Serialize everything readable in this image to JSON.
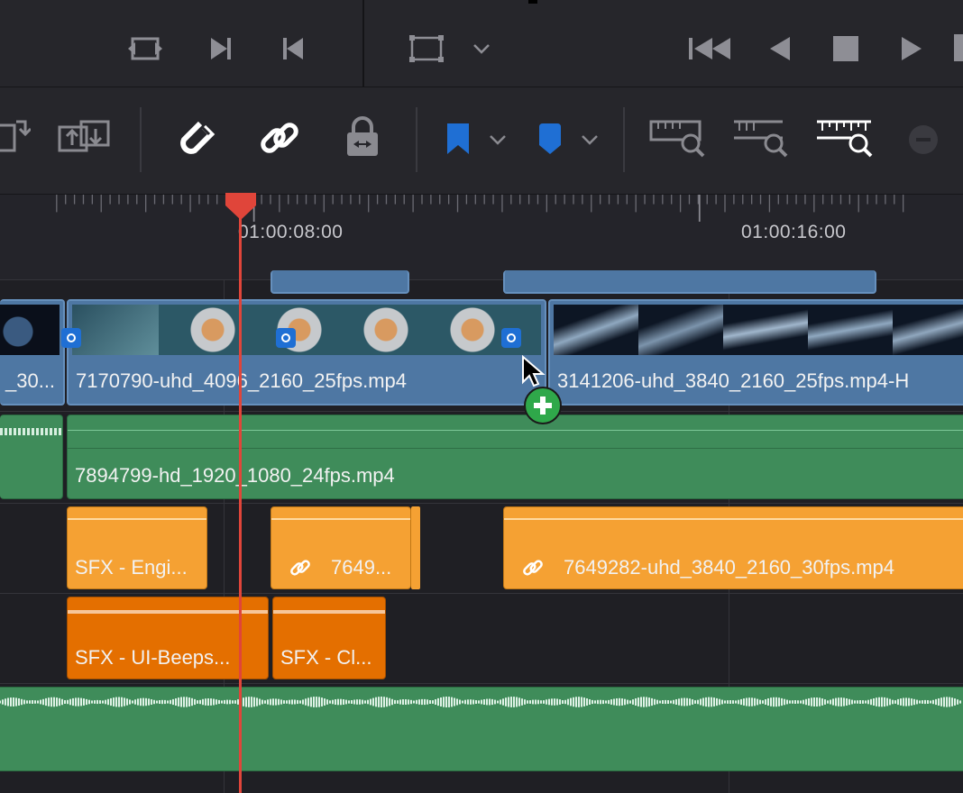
{
  "timeline": {
    "timecodes": [
      "01:00:08:00",
      "01:00:16:00"
    ]
  },
  "clips": {
    "video": [
      {
        "label": "_30..."
      },
      {
        "label": "7170790-uhd_4096_2160_25fps.mp4"
      },
      {
        "label": "3141206-uhd_3840_2160_25fps.mp4-H"
      }
    ],
    "green_audio": {
      "label": "7894799-hd_1920_1080_24fps.mp4"
    },
    "orange_row1": [
      {
        "label": "SFX - Engi..."
      },
      {
        "label": "7649..."
      },
      {
        "label": "7649282-uhd_3840_2160_30fps.mp4"
      }
    ],
    "orange_row2": [
      {
        "label": "SFX - UI-Beeps..."
      },
      {
        "label": "SFX - Cl..."
      }
    ]
  },
  "colors": {
    "playhead": "#e0453a",
    "video_clip": "#4e77a3",
    "audio_green": "#3f8c5a",
    "audio_orange": "#f5a133",
    "audio_dark_orange": "#e46f00",
    "marker_blue": "#1f6fd4",
    "add_badge": "#2fa84a"
  },
  "icons": {
    "transport": [
      "match-frame-icon",
      "next-edit-icon",
      "previous-edit-icon",
      "transform-icon",
      "go-to-start-icon",
      "reverse-play-icon",
      "stop-icon",
      "play-icon"
    ],
    "toolbar": [
      "insert-clip-icon",
      "overwrite-clip-icon",
      "snapping-magnet-icon",
      "linked-selection-icon",
      "position-lock-icon",
      "flag-icon",
      "marker-icon",
      "zoom-full-icon",
      "zoom-detail-icon",
      "zoom-custom-icon",
      "zoom-out-icon"
    ]
  }
}
